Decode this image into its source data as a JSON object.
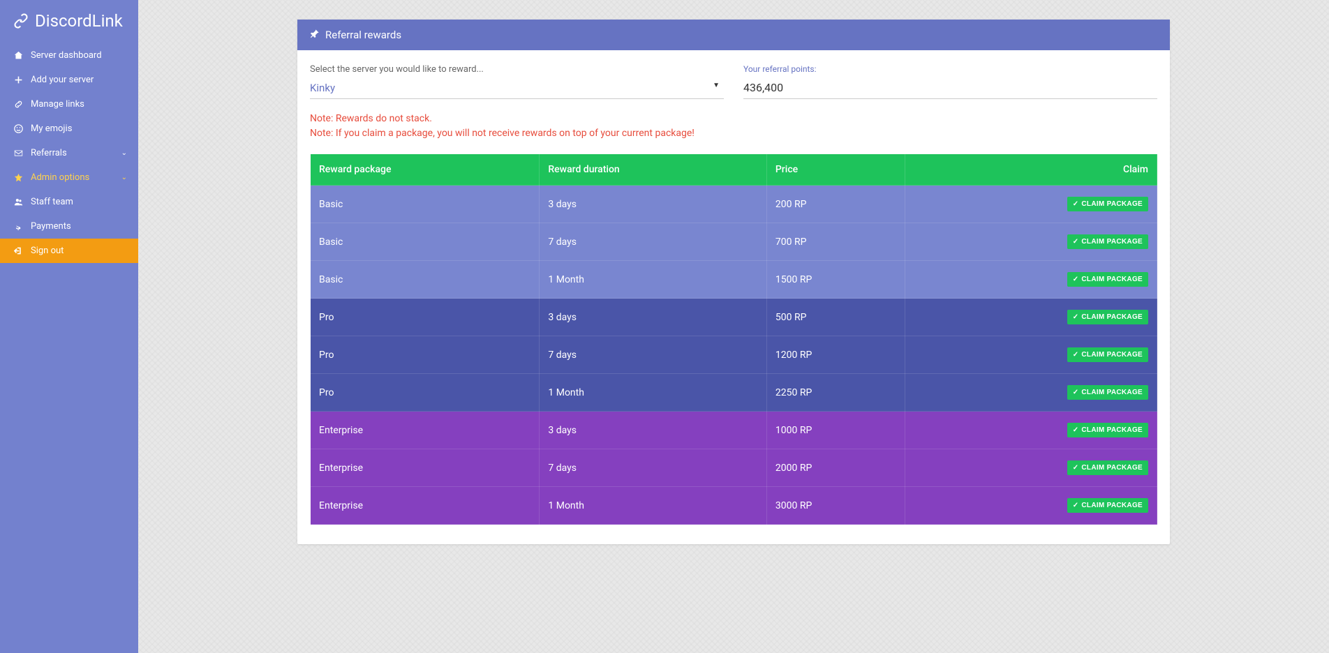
{
  "brand": "DiscordLink",
  "sidebar": {
    "items": [
      {
        "label": "Server dashboard",
        "icon": "home"
      },
      {
        "label": "Add your server",
        "icon": "plus"
      },
      {
        "label": "Manage links",
        "icon": "link"
      },
      {
        "label": "My emojis",
        "icon": "smile"
      },
      {
        "label": "Referrals",
        "icon": "envelope",
        "chevron": true
      },
      {
        "label": "Admin options",
        "icon": "star",
        "chevron": true,
        "active": true
      },
      {
        "label": "Staff team",
        "icon": "users"
      },
      {
        "label": "Payments",
        "icon": "dollar"
      },
      {
        "label": "Sign out",
        "icon": "signout",
        "signout": true
      }
    ]
  },
  "panel": {
    "title": "Referral rewards",
    "select_label": "Select the server you would like to reward...",
    "select_value": "Kinky",
    "points_label": "Your referral points:",
    "points_value": "436,400",
    "note1": "Note: Rewards do not stack.",
    "note2": "Note: If you claim a package, you will not receive rewards on top of your current package!"
  },
  "table": {
    "columns": [
      "Reward package",
      "Reward duration",
      "Price",
      "Claim"
    ],
    "claim_label": "CLAIM PACKAGE",
    "rows": [
      {
        "package": "Basic",
        "duration": "3 days",
        "price": "200 RP",
        "tier": "basic"
      },
      {
        "package": "Basic",
        "duration": "7 days",
        "price": "700 RP",
        "tier": "basic"
      },
      {
        "package": "Basic",
        "duration": "1 Month",
        "price": "1500 RP",
        "tier": "basic"
      },
      {
        "package": "Pro",
        "duration": "3 days",
        "price": "500 RP",
        "tier": "pro"
      },
      {
        "package": "Pro",
        "duration": "7 days",
        "price": "1200 RP",
        "tier": "pro"
      },
      {
        "package": "Pro",
        "duration": "1 Month",
        "price": "2250 RP",
        "tier": "pro"
      },
      {
        "package": "Enterprise",
        "duration": "3 days",
        "price": "1000 RP",
        "tier": "enterprise"
      },
      {
        "package": "Enterprise",
        "duration": "7 days",
        "price": "2000 RP",
        "tier": "enterprise"
      },
      {
        "package": "Enterprise",
        "duration": "1 Month",
        "price": "3000 RP",
        "tier": "enterprise"
      }
    ]
  }
}
